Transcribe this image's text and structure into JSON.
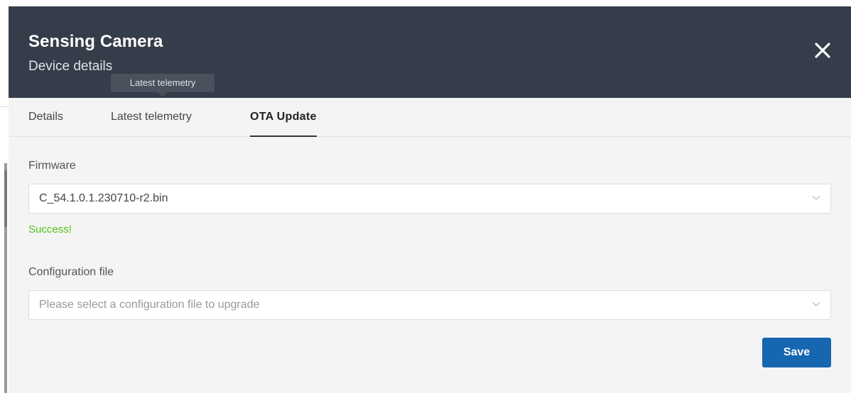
{
  "header": {
    "title": "Sensing Camera",
    "subtitle": "Device details",
    "close_icon": "close-icon"
  },
  "tooltip": {
    "text": "Latest telemetry"
  },
  "tabs": [
    {
      "label": "Details",
      "active": false
    },
    {
      "label": "Latest telemetry",
      "active": false
    },
    {
      "label": "OTA Update",
      "active": true
    }
  ],
  "firmware": {
    "label": "Firmware",
    "value": "C_54.1.0.1.230710-r2.bin",
    "status": "Success!",
    "status_color": "#52c41a"
  },
  "config": {
    "label": "Configuration file",
    "placeholder": "Please select a configuration file to upgrade"
  },
  "actions": {
    "save_label": "Save"
  },
  "colors": {
    "header_bg": "#363d4a",
    "panel_bg": "#f4f4f4",
    "primary": "#1666b0"
  }
}
